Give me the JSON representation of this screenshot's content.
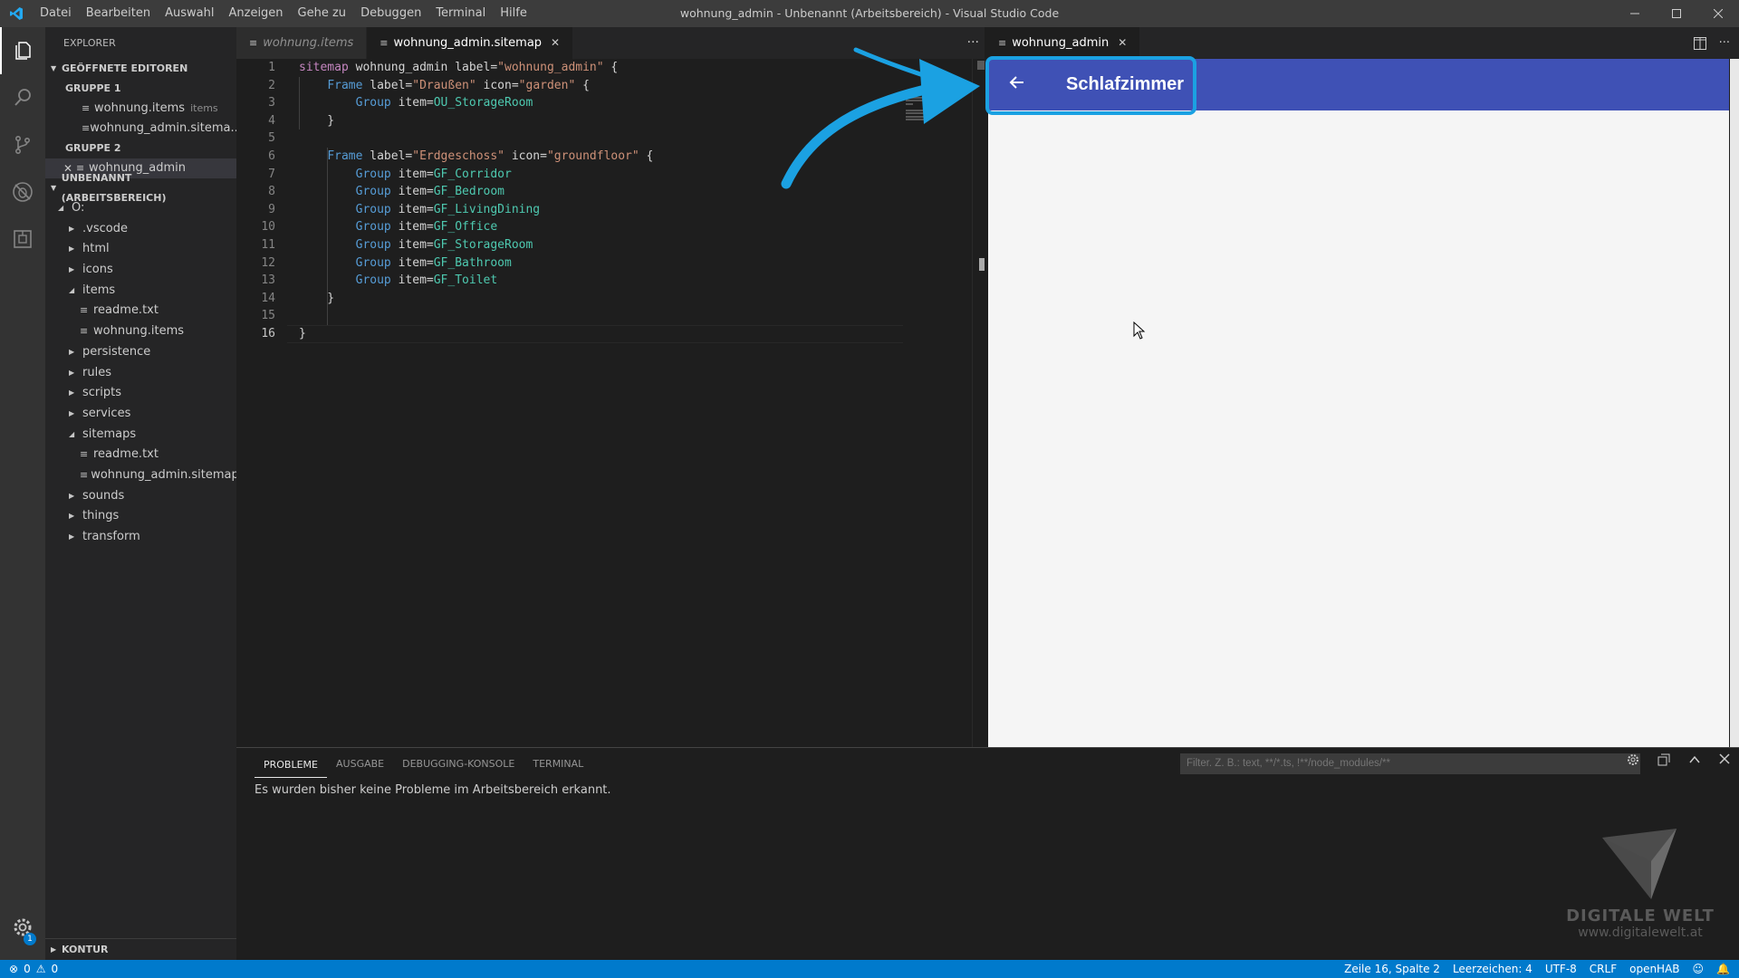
{
  "titlebar": {
    "menus": [
      "Datei",
      "Bearbeiten",
      "Auswahl",
      "Anzeigen",
      "Gehe zu",
      "Debuggen",
      "Terminal",
      "Hilfe"
    ],
    "window_title": "wohnung_admin - Unbenannt (Arbeitsbereich) - Visual Studio Code"
  },
  "sidebar": {
    "title": "EXPLORER",
    "open_editors_header": "GEÖFFNETE EDITOREN",
    "group1_label": "GRUPPE 1",
    "group1_items": [
      {
        "name": "wohnung.items",
        "desc": "items"
      },
      {
        "name": "wohnung_admin.sitema..."
      }
    ],
    "group2_label": "GRUPPE 2",
    "group2_items": [
      {
        "name": "wohnung_admin"
      }
    ],
    "workspace_header": "UNBENANNT (ARBEITSBEREICH)",
    "tree": [
      {
        "label": "O:",
        "depth": 0,
        "type": "folder-open"
      },
      {
        "label": ".vscode",
        "depth": 1,
        "type": "folder"
      },
      {
        "label": "html",
        "depth": 1,
        "type": "folder"
      },
      {
        "label": "icons",
        "depth": 1,
        "type": "folder"
      },
      {
        "label": "items",
        "depth": 1,
        "type": "folder-open"
      },
      {
        "label": "readme.txt",
        "depth": 2,
        "type": "file"
      },
      {
        "label": "wohnung.items",
        "depth": 2,
        "type": "file"
      },
      {
        "label": "persistence",
        "depth": 1,
        "type": "folder"
      },
      {
        "label": "rules",
        "depth": 1,
        "type": "folder"
      },
      {
        "label": "scripts",
        "depth": 1,
        "type": "folder"
      },
      {
        "label": "services",
        "depth": 1,
        "type": "folder"
      },
      {
        "label": "sitemaps",
        "depth": 1,
        "type": "folder-open"
      },
      {
        "label": "readme.txt",
        "depth": 2,
        "type": "file"
      },
      {
        "label": "wohnung_admin.sitemap",
        "depth": 2,
        "type": "file"
      },
      {
        "label": "sounds",
        "depth": 1,
        "type": "folder"
      },
      {
        "label": "things",
        "depth": 1,
        "type": "folder"
      },
      {
        "label": "transform",
        "depth": 1,
        "type": "folder"
      }
    ],
    "outline_header": "KONTUR",
    "settings_badge": "1"
  },
  "editor1": {
    "tabs": [
      {
        "label": "wohnung.items",
        "active": false
      },
      {
        "label": "wohnung_admin.sitemap",
        "active": true
      }
    ],
    "current_line": 16,
    "lines": [
      {
        "n": 1,
        "html": "<span class=\"kw\">sitemap</span> wohnung_admin label=<span class=\"str\">\"wohnung_admin\"</span> {"
      },
      {
        "n": 2,
        "html": "    <span class=\"kw2\">Frame</span> label=<span class=\"str\">\"Draußen\"</span> icon=<span class=\"str\">\"garden\"</span> {"
      },
      {
        "n": 3,
        "html": "        <span class=\"kw2\">Group</span> item=<span class=\"itm\">OU_StorageRoom</span>"
      },
      {
        "n": 4,
        "html": "    }"
      },
      {
        "n": 5,
        "html": ""
      },
      {
        "n": 6,
        "html": "    <span class=\"kw2\">Frame</span> label=<span class=\"str\">\"Erdgeschoss\"</span> icon=<span class=\"str\">\"groundfloor\"</span> {"
      },
      {
        "n": 7,
        "html": "        <span class=\"kw2\">Group</span> item=<span class=\"itm\">GF_Corridor</span>"
      },
      {
        "n": 8,
        "html": "        <span class=\"kw2\">Group</span> item=<span class=\"itm\">GF_Bedroom</span>"
      },
      {
        "n": 9,
        "html": "        <span class=\"kw2\">Group</span> item=<span class=\"itm\">GF_LivingDining</span>"
      },
      {
        "n": 10,
        "html": "        <span class=\"kw2\">Group</span> item=<span class=\"itm\">GF_Office</span>"
      },
      {
        "n": 11,
        "html": "        <span class=\"kw2\">Group</span> item=<span class=\"itm\">GF_StorageRoom</span>"
      },
      {
        "n": 12,
        "html": "        <span class=\"kw2\">Group</span> item=<span class=\"itm\">GF_Bathroom</span>"
      },
      {
        "n": 13,
        "html": "        <span class=\"kw2\">Group</span> item=<span class=\"itm\">GF_Toilet</span>"
      },
      {
        "n": 14,
        "html": "    }"
      },
      {
        "n": 15,
        "html": ""
      },
      {
        "n": 16,
        "html": "}"
      }
    ]
  },
  "editor2": {
    "tab_label": "wohnung_admin",
    "preview_title": "Schlafzimmer"
  },
  "panel": {
    "tabs": [
      "PROBLEME",
      "AUSGABE",
      "DEBUGGING-KONSOLE",
      "TERMINAL"
    ],
    "filter_placeholder": "Filter. Z. B.: text, **/*.ts, !**/node_modules/**",
    "message": "Es wurden bisher keine Probleme im Arbeitsbereich erkannt."
  },
  "watermark": {
    "brand": "DIGITALE WELT",
    "url": "www.digitalewelt.at"
  },
  "statusbar": {
    "errors": "0",
    "warnings": "0",
    "position": "Zeile 16, Spalte 2",
    "spaces": "Leerzeichen: 4",
    "encoding": "UTF-8",
    "eol": "CRLF",
    "language": "openHAB"
  },
  "colors": {
    "accent": "#007acc",
    "preview_header": "#3f51b5",
    "highlight": "#1ba1e2"
  }
}
